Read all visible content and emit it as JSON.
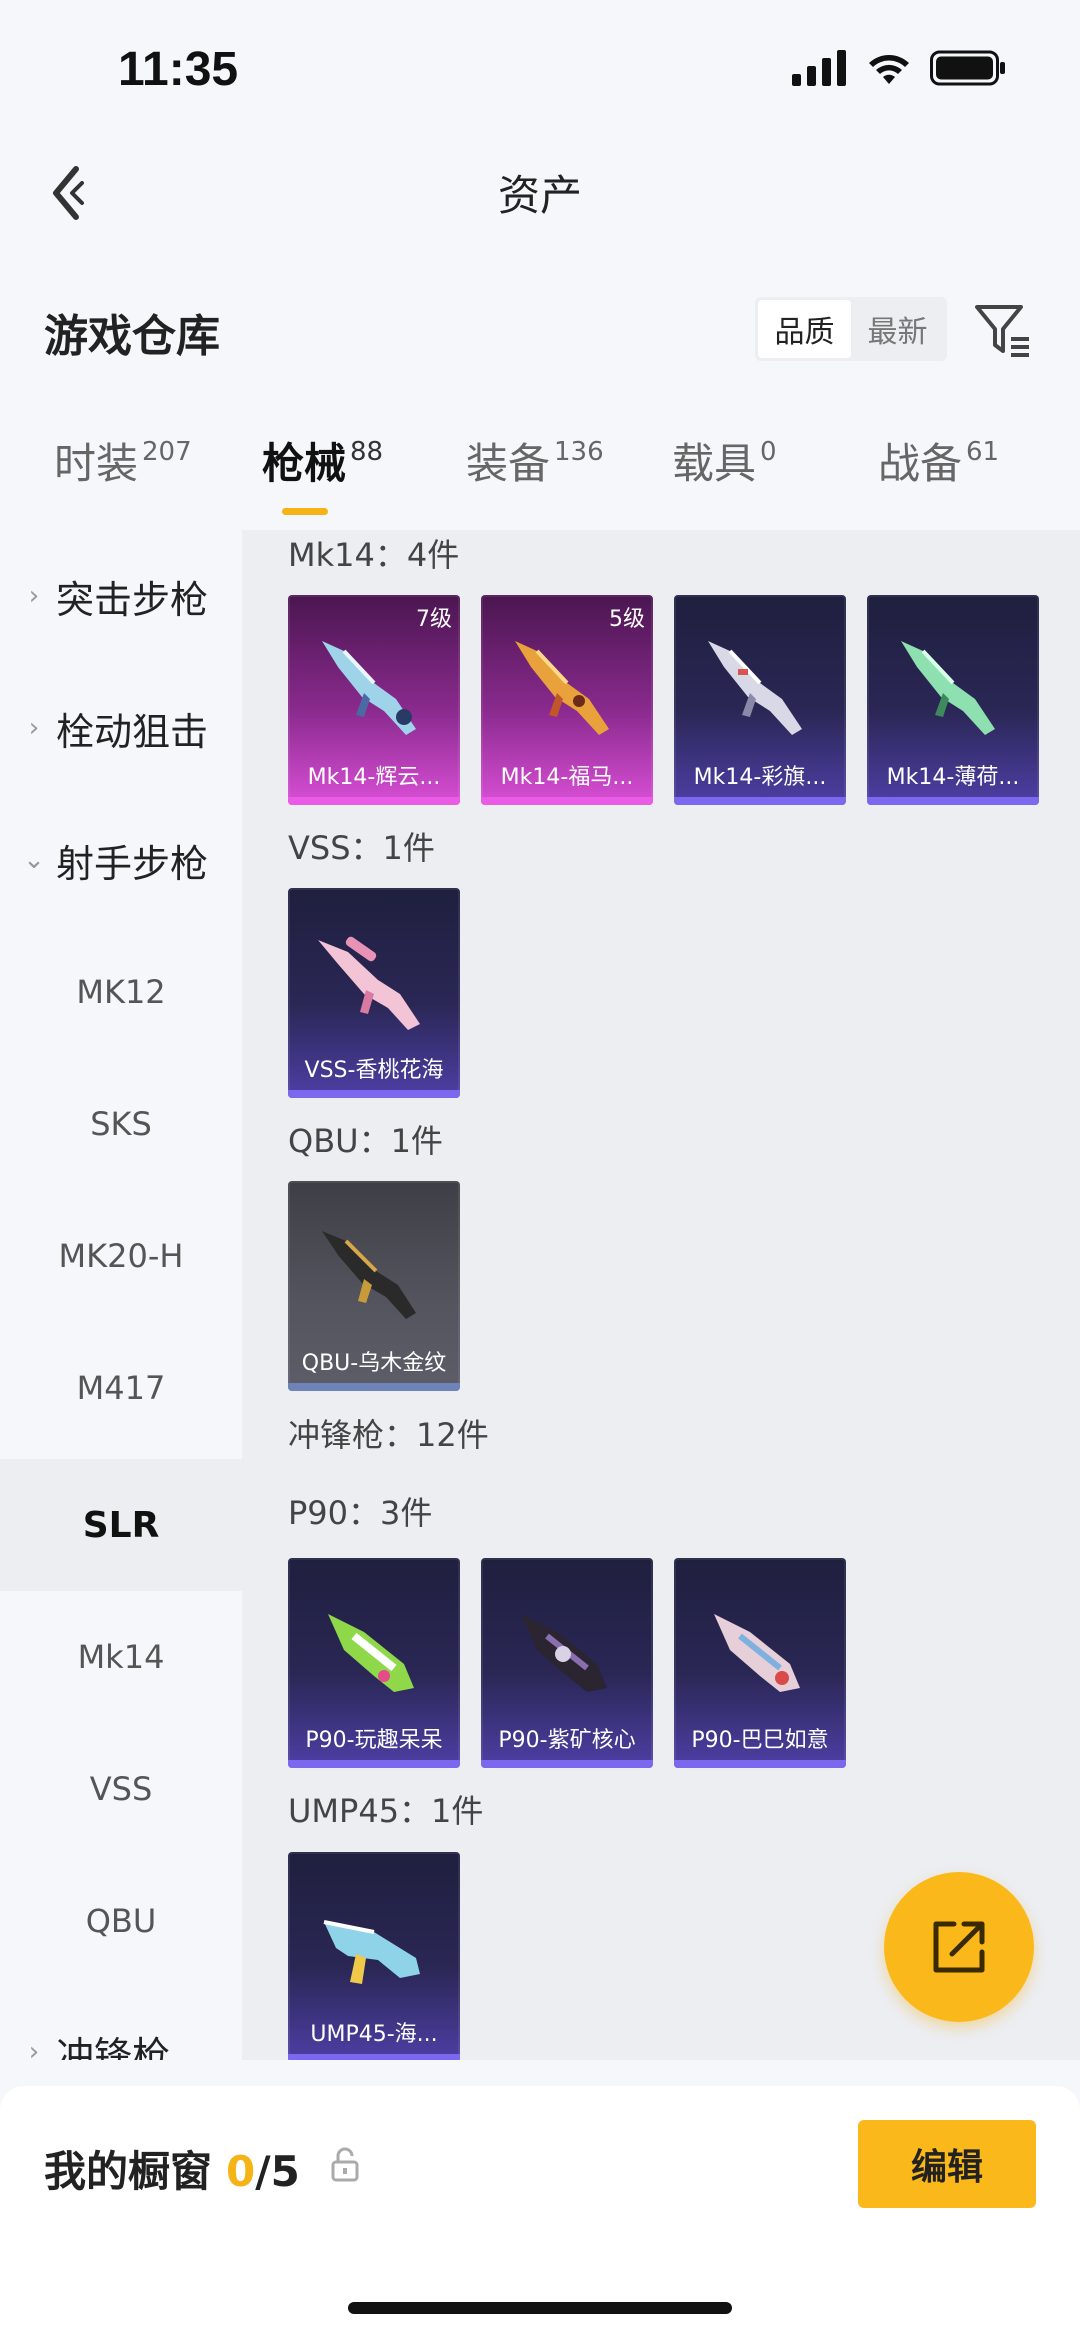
{
  "status_bar": {
    "time": "11:35"
  },
  "header": {
    "title": "资产"
  },
  "warehouse": {
    "title": "游戏仓库",
    "sort_options": [
      {
        "label": "品质",
        "active": true
      },
      {
        "label": "最新",
        "active": false
      }
    ]
  },
  "tabs": [
    {
      "label": "时装",
      "count": "207",
      "active": false
    },
    {
      "label": "枪械",
      "count": "88",
      "active": true
    },
    {
      "label": "装备",
      "count": "136",
      "active": false
    },
    {
      "label": "载具",
      "count": "0",
      "active": false
    },
    {
      "label": "战备",
      "count": "61",
      "active": false
    }
  ],
  "sidebar": {
    "items": [
      {
        "label": "突击步枪",
        "type": "group",
        "expanded": false
      },
      {
        "label": "栓动狙击",
        "type": "group",
        "expanded": false
      },
      {
        "label": "射手步枪",
        "type": "group",
        "expanded": true
      },
      {
        "label": "MK12",
        "type": "sub"
      },
      {
        "label": "SKS",
        "type": "sub"
      },
      {
        "label": "MK20-H",
        "type": "sub"
      },
      {
        "label": "M417",
        "type": "sub"
      },
      {
        "label": "SLR",
        "type": "sub",
        "selected": true
      },
      {
        "label": "Mk14",
        "type": "sub"
      },
      {
        "label": "VSS",
        "type": "sub"
      },
      {
        "label": "QBU",
        "type": "sub"
      },
      {
        "label": "冲锋枪",
        "type": "group",
        "expanded": false
      }
    ]
  },
  "content": {
    "sections": [
      {
        "title": "Mk14：4件",
        "items": [
          {
            "name": "Mk14-辉云...",
            "level": "7级",
            "rarity": "pink"
          },
          {
            "name": "Mk14-福马...",
            "level": "5级",
            "rarity": "pink"
          },
          {
            "name": "Mk14-彩旗...",
            "level": "",
            "rarity": "purple"
          },
          {
            "name": "Mk14-薄荷...",
            "level": "",
            "rarity": "purple"
          }
        ]
      },
      {
        "title": "VSS：1件",
        "items": [
          {
            "name": "VSS-香桃花海",
            "level": "",
            "rarity": "purple"
          }
        ]
      },
      {
        "title": "QBU：1件",
        "items": [
          {
            "name": "QBU-乌木金纹",
            "level": "",
            "rarity": "gray"
          }
        ]
      },
      {
        "title": "冲锋枪：12件",
        "items": []
      },
      {
        "title": "P90：3件",
        "items": [
          {
            "name": "P90-玩趣呆呆",
            "level": "",
            "rarity": "purple"
          },
          {
            "name": "P90-紫矿核心",
            "level": "",
            "rarity": "purple"
          },
          {
            "name": "P90-巴巳如意",
            "level": "",
            "rarity": "purple"
          }
        ]
      },
      {
        "title": "UMP45：1件",
        "items": [
          {
            "name": "UMP45-海...",
            "level": "",
            "rarity": "purple"
          }
        ]
      }
    ]
  },
  "showcase": {
    "label": "我的橱窗",
    "current": "0",
    "total": "/5",
    "edit_label": "编辑"
  },
  "icons": {
    "back": "chevron-left-icon",
    "filter": "filter-icon",
    "share": "share-icon",
    "lock": "lock-icon"
  },
  "colors": {
    "accent": "#fbb81a",
    "tab_underline": "#f5b316"
  }
}
